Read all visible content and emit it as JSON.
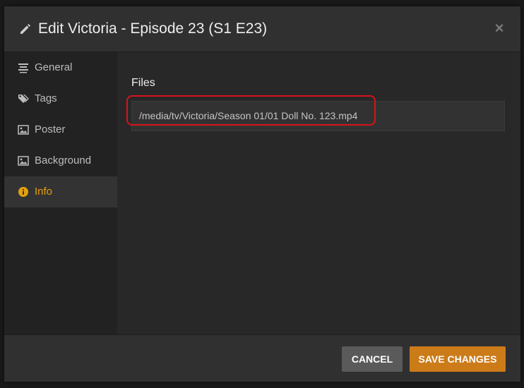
{
  "header": {
    "title": "Edit Victoria - Episode 23 (S1 E23)",
    "edit_icon": "pencil-icon",
    "close_label": "×"
  },
  "sidebar": {
    "items": [
      {
        "label": "General",
        "icon": "align-center-icon",
        "active": false
      },
      {
        "label": "Tags",
        "icon": "tags-icon",
        "active": false
      },
      {
        "label": "Poster",
        "icon": "image-icon",
        "active": false
      },
      {
        "label": "Background",
        "icon": "image-icon",
        "active": false
      },
      {
        "label": "Info",
        "icon": "info-circle-icon",
        "active": true
      }
    ]
  },
  "main": {
    "section_label": "Files",
    "files": [
      "/media/tv/Victoria/Season 01/01 Doll No. 123.mp4"
    ]
  },
  "footer": {
    "cancel_label": "CANCEL",
    "save_label": "SAVE CHANGES"
  },
  "colors": {
    "accent": "#e5a00d",
    "save_button": "#cc7b19",
    "cancel_button": "#5a5a5a",
    "highlight": "#d8131b"
  }
}
